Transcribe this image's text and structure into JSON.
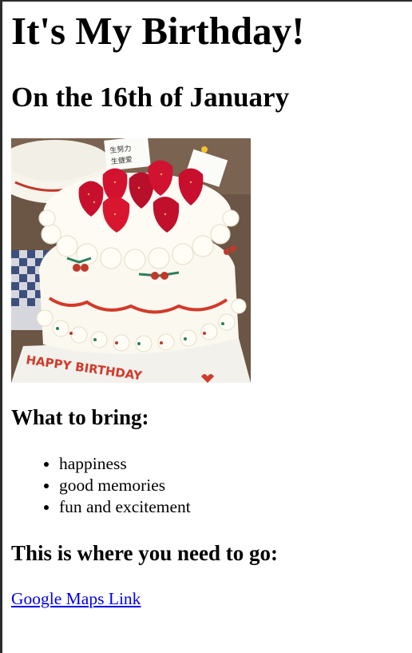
{
  "page": {
    "title": "It's My Birthday!",
    "subtitle": "On the 16th of January"
  },
  "image": {
    "subject": "strawberry birthday cake",
    "caption_on_cake": "HAPPY BIRTHDAY",
    "sign_text": "生努力 生健爱"
  },
  "bring": {
    "heading": "What to bring:",
    "items": [
      "happiness",
      "good memories",
      "fun and excitement"
    ]
  },
  "location": {
    "heading": "This is where you need to go:",
    "link_label": "Google Maps Link"
  },
  "colors": {
    "link": "#0000ee",
    "text": "#000000",
    "frame": "#2b2b2b"
  }
}
